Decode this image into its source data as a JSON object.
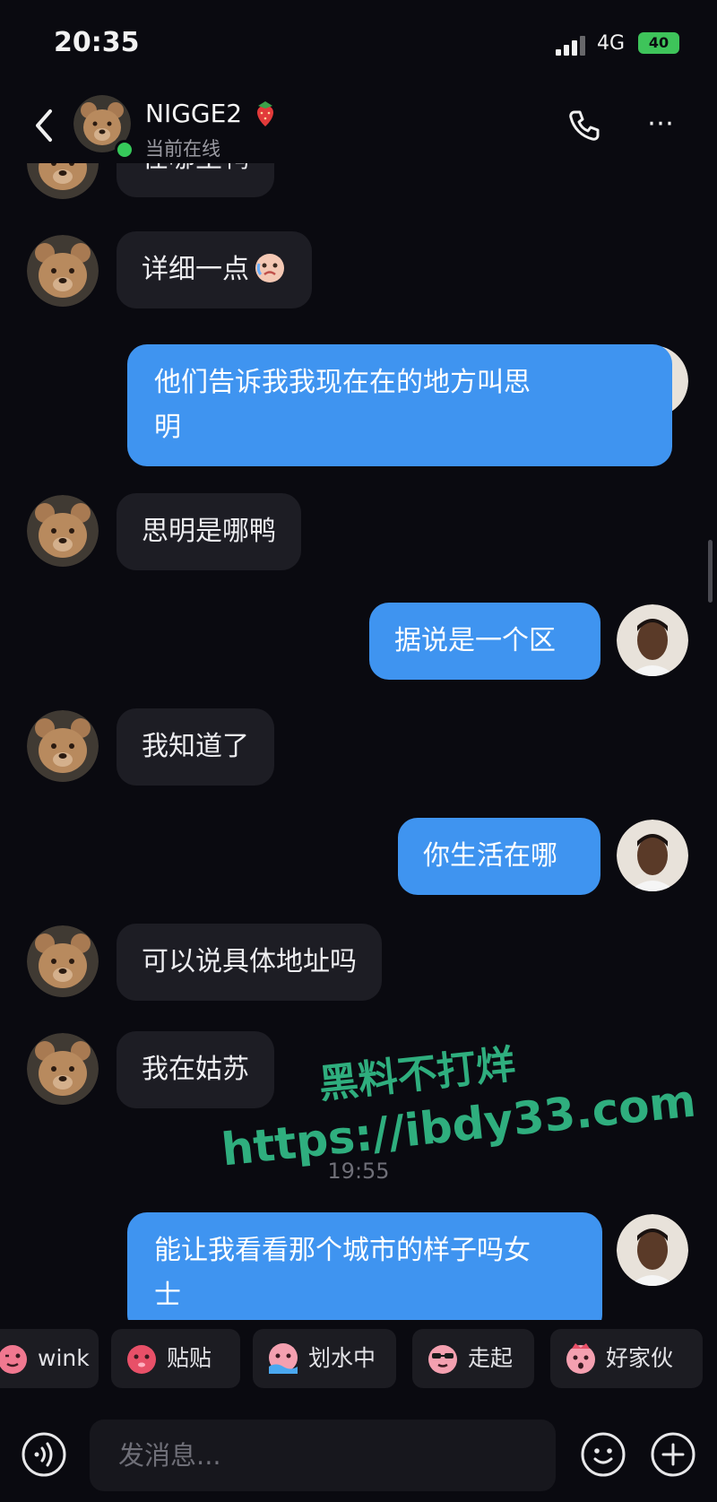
{
  "status_bar": {
    "time": "20:35",
    "network": "4G",
    "battery": "40"
  },
  "header": {
    "name": "NIGGE2",
    "status": "当前在线"
  },
  "messages": [
    {
      "from": "them",
      "text": "在哪里鸭"
    },
    {
      "from": "them",
      "text": "详细一点"
    },
    {
      "from": "me",
      "line1": "他们告诉我我现在在的地方叫思",
      "line2": "明"
    },
    {
      "from": "them",
      "text": "思明是哪鸭"
    },
    {
      "from": "me",
      "text": "据说是一个区"
    },
    {
      "from": "them",
      "text": "我知道了"
    },
    {
      "from": "me",
      "text": "你生活在哪"
    },
    {
      "from": "them",
      "text": "可以说具体地址吗"
    },
    {
      "from": "them",
      "text": "我在姑苏"
    },
    {
      "from": "me",
      "line1": "能让我看看那个城市的样子吗女",
      "line2": "士"
    }
  ],
  "timestamp": "19:55",
  "watermark": {
    "line1": "黑料不打烊",
    "line2": "https://ibdy33.com"
  },
  "stickers": [
    {
      "label": "wink",
      "icon": "wink-sticker-icon"
    },
    {
      "label": "贴贴",
      "icon": "hug-sticker-icon"
    },
    {
      "label": "划水中",
      "icon": "swimming-sticker-icon"
    },
    {
      "label": "走起",
      "icon": "cool-sticker-icon"
    },
    {
      "label": "好家伙",
      "icon": "surprised-sticker-icon"
    }
  ],
  "input": {
    "placeholder": "发消息..."
  },
  "colors": {
    "outgoing_bubble": "#3f94f0",
    "incoming_bubble": "#1d1d24",
    "online": "#36c95a",
    "watermark": "#2fae7e"
  }
}
